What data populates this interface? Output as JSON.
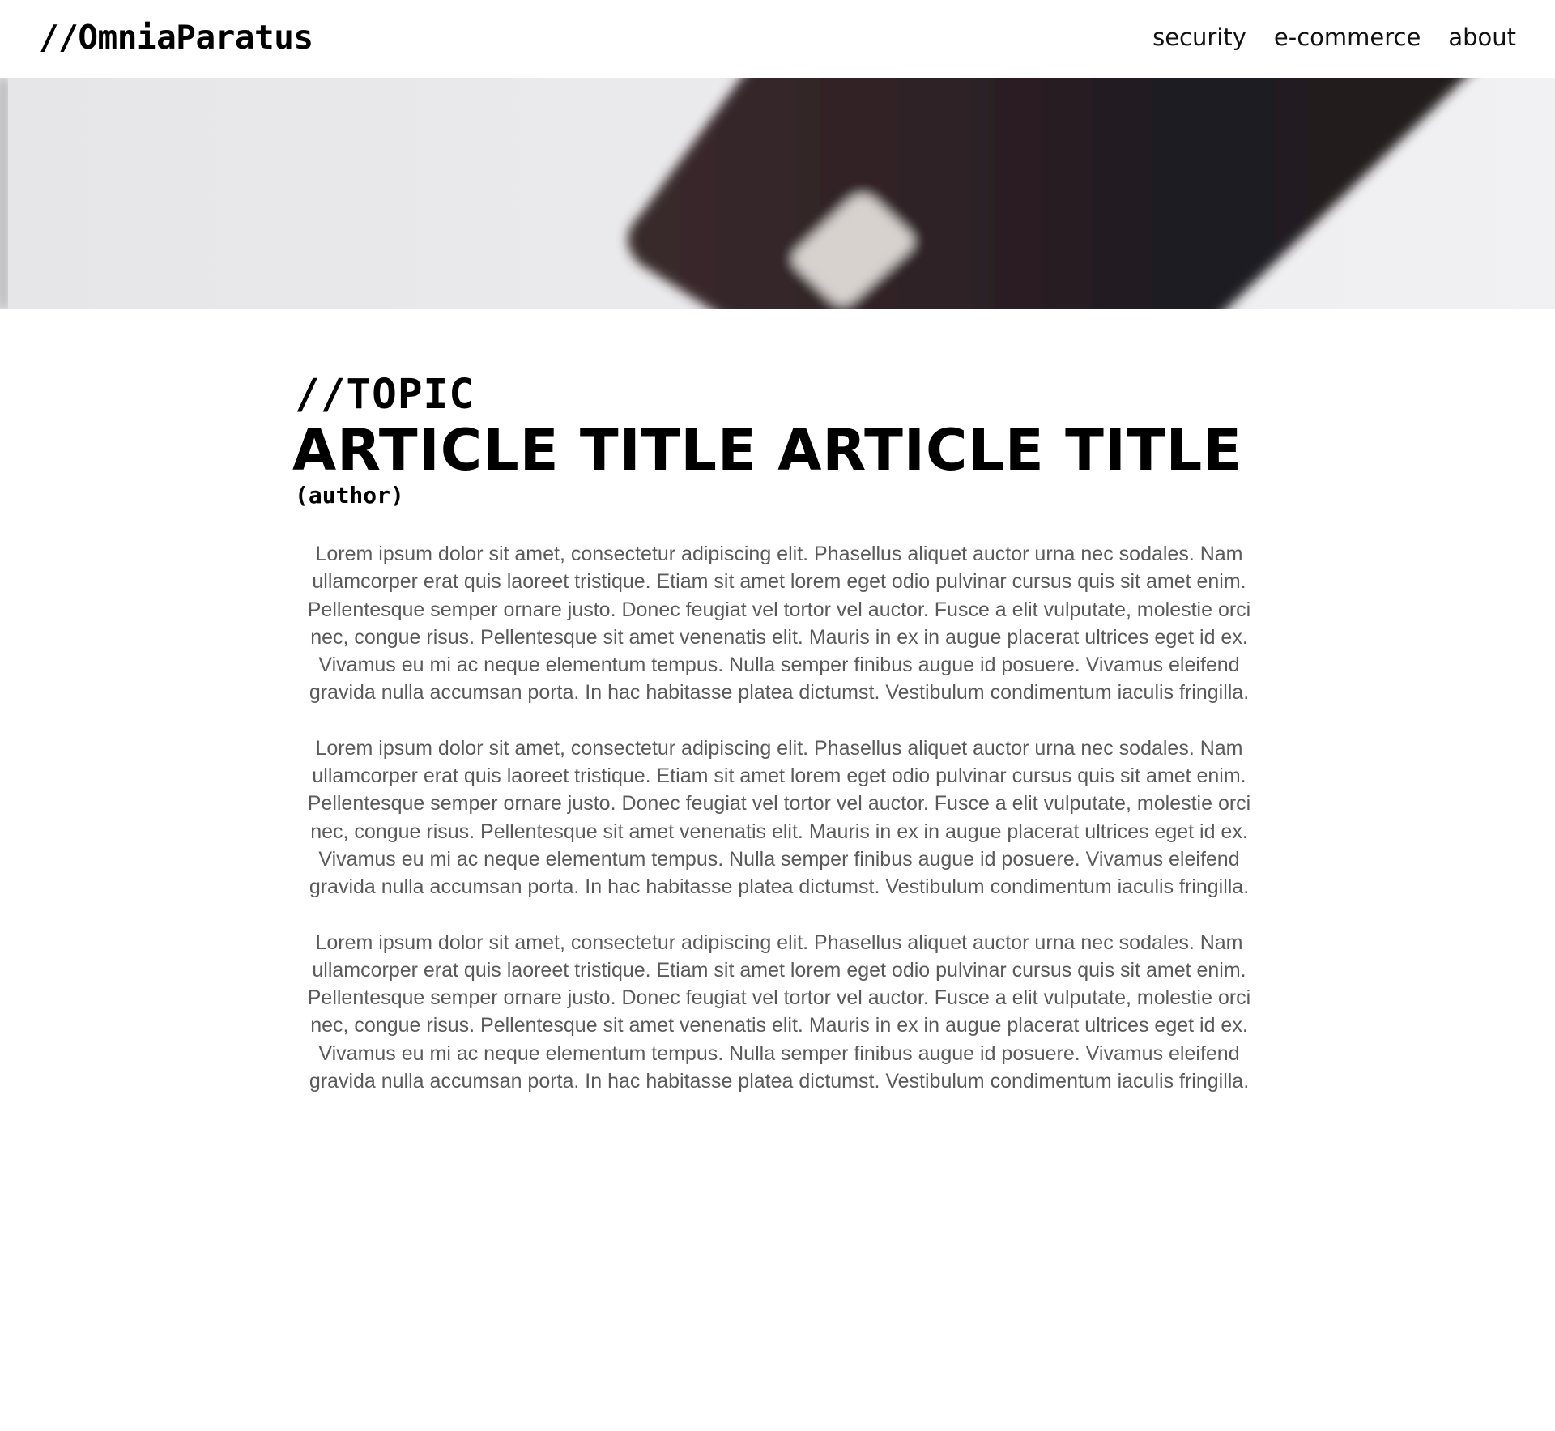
{
  "header": {
    "logo": "//OmniaParatus",
    "nav": [
      {
        "label": "security"
      },
      {
        "label": "e-commerce"
      },
      {
        "label": "about"
      }
    ]
  },
  "hero": {
    "image": "blurred-credit-card-image"
  },
  "article": {
    "topic": "//TOPIC",
    "title": "ARTICLE TITLE ARTICLE TITLE",
    "author": "(author)",
    "paragraphs": [
      "Lorem ipsum dolor sit amet, consectetur adipiscing elit. Phasellus aliquet auctor urna nec sodales. Nam ullamcorper erat quis laoreet tristique. Etiam sit amet lorem eget odio pulvinar cursus quis sit amet enim. Pellentesque semper ornare justo. Donec feugiat vel tortor vel auctor. Fusce a elit vulputate, molestie orci nec, congue risus. Pellentesque sit amet venenatis elit. Mauris in ex in augue placerat ultrices eget id ex. Vivamus eu mi ac neque elementum tempus. Nulla semper finibus augue id posuere. Vivamus eleifend gravida nulla accumsan porta. In hac habitasse platea dictumst. Vestibulum condimentum iaculis fringilla.",
      "Lorem ipsum dolor sit amet, consectetur adipiscing elit. Phasellus aliquet auctor urna nec sodales. Nam ullamcorper erat quis laoreet tristique. Etiam sit amet lorem eget odio pulvinar cursus quis sit amet enim. Pellentesque semper ornare justo. Donec feugiat vel tortor vel auctor. Fusce a elit vulputate, molestie orci nec, congue risus. Pellentesque sit amet venenatis elit. Mauris in ex in augue placerat ultrices eget id ex. Vivamus eu mi ac neque elementum tempus. Nulla semper finibus augue id posuere. Vivamus eleifend gravida nulla accumsan porta. In hac habitasse platea dictumst. Vestibulum condimentum iaculis fringilla.",
      "Lorem ipsum dolor sit amet, consectetur adipiscing elit. Phasellus aliquet auctor urna nec sodales. Nam ullamcorper erat quis laoreet tristique. Etiam sit amet lorem eget odio pulvinar cursus quis sit amet enim. Pellentesque semper ornare justo. Donec feugiat vel tortor vel auctor. Fusce a elit vulputate, molestie orci nec, congue risus. Pellentesque sit amet venenatis elit. Mauris in ex in augue placerat ultrices eget id ex. Vivamus eu mi ac neque elementum tempus. Nulla semper finibus augue id posuere. Vivamus eleifend gravida nulla accumsan porta. In hac habitasse platea dictumst. Vestibulum condimentum iaculis fringilla."
    ]
  },
  "colors": {
    "background": "#ffffff",
    "text": "#000000",
    "body_text": "#5a5a5a",
    "card": "#2a1f22"
  }
}
